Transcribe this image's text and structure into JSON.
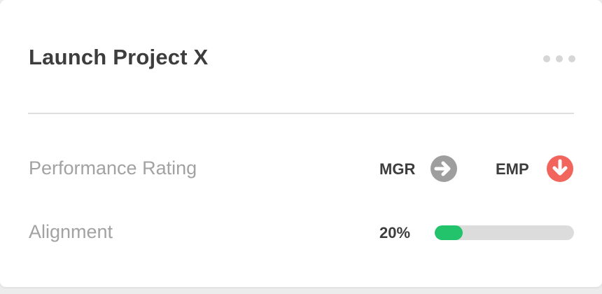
{
  "card": {
    "title": "Launch Project X",
    "more_icon": "more-horizontal-icon"
  },
  "rows": {
    "performance": {
      "label": "Performance Rating",
      "mgr_label": "MGR",
      "mgr_icon": "arrow-right-circle-icon",
      "mgr_icon_color": "#9e9e9e",
      "emp_label": "EMP",
      "emp_icon": "arrow-down-circle-icon",
      "emp_icon_color": "#f2655d"
    },
    "alignment": {
      "label": "Alignment",
      "percent_text": "20%",
      "progress": 0.2,
      "progress_color": "#22c36a",
      "track_color": "#dcdcdc"
    }
  }
}
